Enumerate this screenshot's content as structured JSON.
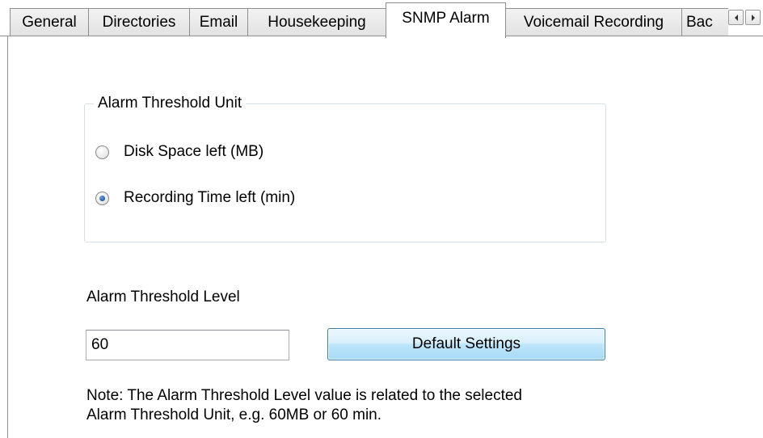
{
  "tabs": [
    {
      "label": "General",
      "active": false
    },
    {
      "label": "Directories",
      "active": false
    },
    {
      "label": "Email",
      "active": false
    },
    {
      "label": "Housekeeping",
      "active": false
    },
    {
      "label": "SNMP Alarm",
      "active": true
    },
    {
      "label": "Voicemail Recording",
      "active": false
    },
    {
      "label": "Bac",
      "active": false
    }
  ],
  "tab_scroll": {
    "left_icon": "arrow-left-icon",
    "right_icon": "arrow-right-icon"
  },
  "alarm_unit": {
    "group_title": "Alarm Threshold Unit",
    "options": [
      {
        "label": "Disk Space left (MB)",
        "selected": false
      },
      {
        "label": "Recording Time left (min)",
        "selected": true
      }
    ]
  },
  "alarm_level": {
    "label": "Alarm Threshold Level",
    "value": "60",
    "default_button_label": "Default Settings"
  },
  "note": {
    "line1": "Note: The Alarm Threshold Level value is related to the selected",
    "line2": "Alarm Threshold Unit, e.g. 60MB or 60 min."
  },
  "colors": {
    "selected_radio": "#1a4f9c",
    "button_border": "#3c7fb1",
    "group_border": "#d5dfe5"
  }
}
